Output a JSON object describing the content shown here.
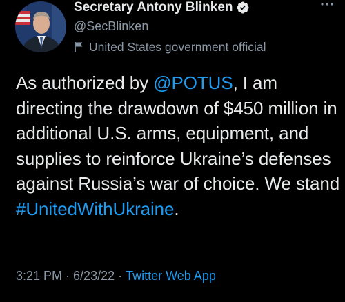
{
  "account": {
    "display_name": "Secretary Antony Blinken",
    "handle": "@SecBlinken",
    "label": "United States government official"
  },
  "tweet": {
    "text_1": "As authorized by ",
    "mention": "@POTUS",
    "text_2": ", I am directing the drawdown of $450 million in additional U.S. arms, equipment, and supplies to reinforce Ukraine’s defenses against Russia’s war of choice. We stand ",
    "hashtag": "#UnitedWithUkraine",
    "text_3": "."
  },
  "meta": {
    "time": "3:21 PM",
    "separator": "·",
    "date": "6/23/22",
    "source": "Twitter Web App"
  },
  "colors": {
    "background": "#000000",
    "primary_text": "#e7e9ea",
    "secondary_text": "#8b98a5",
    "link": "#1d9bf0"
  },
  "icons": {
    "verified": "verified-badge-icon",
    "label": "flag-icon",
    "more": "more-options-icon"
  }
}
